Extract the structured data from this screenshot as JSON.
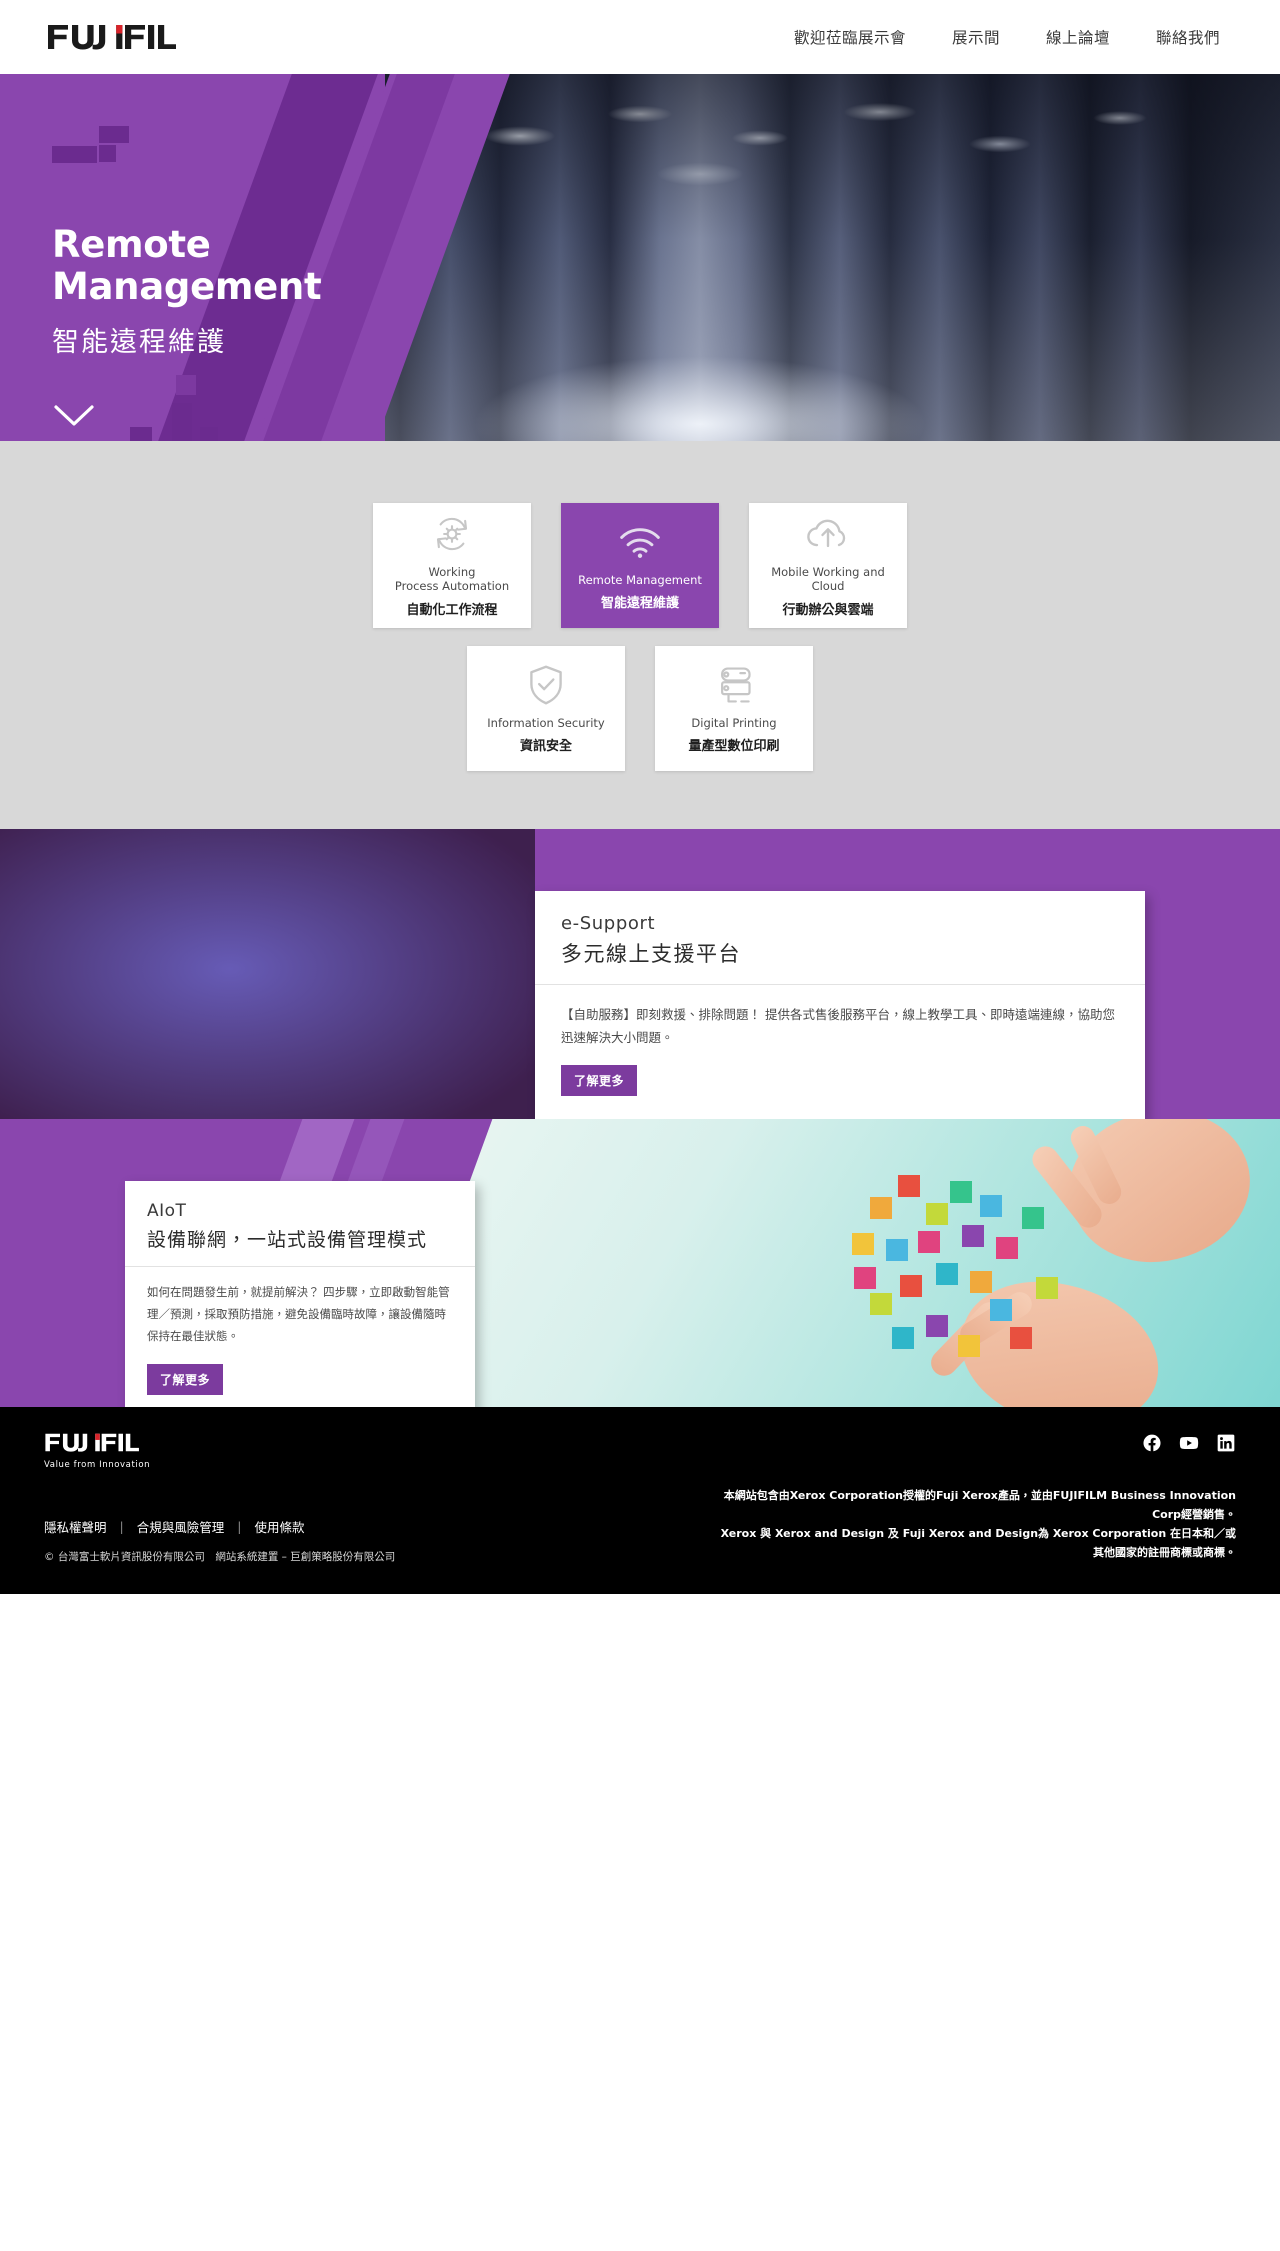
{
  "header": {
    "logo_text": "FUJIFILM",
    "nav": [
      {
        "label": "歡迎莅臨展示會",
        "name": "nav-welcome"
      },
      {
        "label": "展示間",
        "name": "nav-showroom"
      },
      {
        "label": "線上論壇",
        "name": "nav-forum"
      },
      {
        "label": "聯絡我們",
        "name": "nav-contact"
      }
    ]
  },
  "hero": {
    "title_line1": "Remote",
    "title_line2": "Management",
    "subtitle": "智能遠程維護",
    "scroll_icon": "chevron-down-icon"
  },
  "categories": [
    {
      "icon": "process-automation-icon",
      "en_line1": "Working",
      "en_line2": "Process Automation",
      "zh": "自動化工作流程",
      "active": false
    },
    {
      "icon": "wifi-icon",
      "en_line1": "Remote Management",
      "en_line2": "",
      "zh": "智能遠程維護",
      "active": true
    },
    {
      "icon": "cloud-upload-icon",
      "en_line1": "Mobile Working and Cloud",
      "en_line2": "",
      "zh": "行動辦公與雲端",
      "active": false
    },
    {
      "icon": "shield-check-icon",
      "en_line1": "Information Security",
      "en_line2": "",
      "zh": "資訊安全",
      "active": false
    },
    {
      "icon": "printing-press-icon",
      "en_line1": "Digital Printing",
      "en_line2": "",
      "zh": "量產型數位印刷",
      "active": false
    }
  ],
  "support": {
    "en_title": "e-Support",
    "zh_title": "多元線上支援平台",
    "description": "【自助服務】即刻救援、排除問題！ 提供各式售後服務平台，線上教學工具、即時遠端連線，協助您迅速解決大小問題。",
    "button_label": "了解更多"
  },
  "aiot": {
    "en_title": "AIoT",
    "zh_title": "設備聯網，一站式設備管理模式",
    "description": "如何在問題發生前，就提前解決？ 四步驟，立即啟動智能管理／預測，採取預防措施，避免設備臨時故障，讓設備隨時保持在最佳狀態。",
    "button_label": "了解更多"
  },
  "footer": {
    "logo_text": "FUJIFILM",
    "tagline": "Value from Innovation",
    "social": [
      {
        "name": "facebook-icon",
        "label": "Facebook"
      },
      {
        "name": "youtube-icon",
        "label": "YouTube"
      },
      {
        "name": "linkedin-icon",
        "label": "LinkedIn"
      }
    ],
    "links": [
      {
        "label": "隱私權聲明",
        "name": "footer-link-privacy"
      },
      {
        "label": "合規與風險管理",
        "name": "footer-link-compliance"
      },
      {
        "label": "使用條款",
        "name": "footer-link-terms"
      }
    ],
    "separator": "|",
    "copyright": "© 台灣富士軟片資訊股份有限公司　網站系統建置 – 巨創策略股份有限公司",
    "legal_line1": "本網站包含由Xerox Corporation授權的Fuji Xerox產品，並由FUJIFILM Business Innovation",
    "legal_line2": "Corp經營銷售。",
    "legal_line3": "Xerox 與 Xerox and Design 及 Fuji Xerox and Design為 Xerox Corporation 在日本和／或",
    "legal_line4": "其他國家的註冊商標或商標。"
  },
  "colors": {
    "brand_purple": "#8a46ae",
    "dark_purple": "#6b2b8f",
    "button_purple": "#7c3b9e",
    "logo_red": "#d8232a",
    "page_gray": "#d8d8d8"
  }
}
